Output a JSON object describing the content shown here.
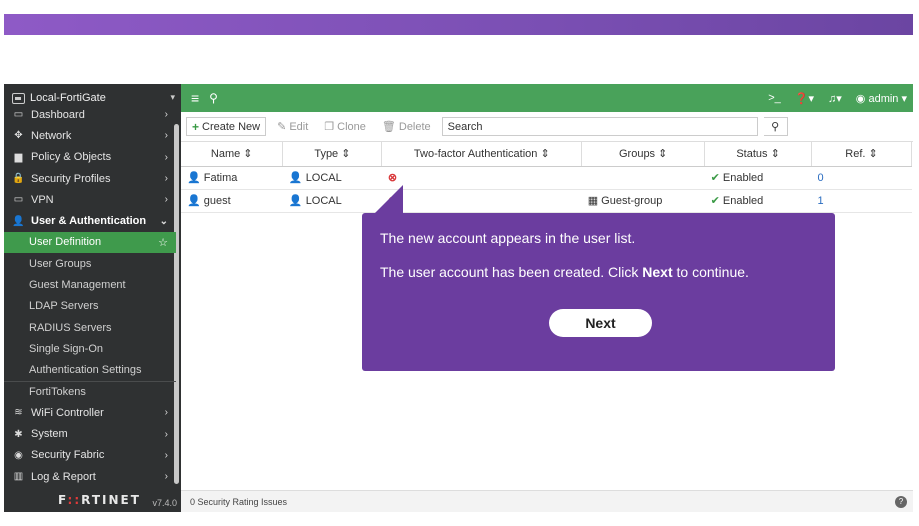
{
  "sidebar": {
    "device": "Local-FortiGate",
    "items": [
      {
        "icon": "dashboard-icon",
        "glyph": "▭",
        "label": "Dashboard"
      },
      {
        "icon": "network-icon",
        "glyph": "✥",
        "label": "Network"
      },
      {
        "icon": "policy-icon",
        "glyph": "▆",
        "label": "Policy & Objects"
      },
      {
        "icon": "lock-icon",
        "glyph": "🔒",
        "label": "Security Profiles"
      },
      {
        "icon": "vpn-icon",
        "glyph": "▭",
        "label": "VPN"
      },
      {
        "icon": "user-icon",
        "glyph": "👤",
        "label": "User & Authentication"
      }
    ],
    "subitems": [
      "User Definition",
      "User Groups",
      "Guest Management",
      "LDAP Servers",
      "RADIUS Servers",
      "Single Sign-On",
      "Authentication Settings",
      "FortiTokens"
    ],
    "items2": [
      {
        "icon": "wifi-icon",
        "glyph": "≋",
        "label": "WiFi Controller"
      },
      {
        "icon": "gear-icon",
        "glyph": "✱",
        "label": "System"
      },
      {
        "icon": "fabric-icon",
        "glyph": "◉",
        "label": "Security Fabric"
      },
      {
        "icon": "chart-icon",
        "glyph": "▥",
        "label": "Log & Report"
      }
    ],
    "brand_a": "F",
    "brand_b": "::",
    "brand_c": "RTINET",
    "version": "v7.4.0"
  },
  "topbar": {
    "admin": "admin"
  },
  "toolbar": {
    "create": "Create New",
    "edit": "Edit",
    "clone": "Clone",
    "delete": "Delete",
    "search_placeholder": "Search"
  },
  "table": {
    "headers": [
      "Name ⇕",
      "Type ⇕",
      "Two-factor Authentication ⇕",
      "Groups ⇕",
      "Status ⇕",
      "Ref. ⇕"
    ],
    "rows": [
      {
        "name": "Fatima",
        "type": "LOCAL",
        "groups": "",
        "status": "Enabled",
        "ref": "0"
      },
      {
        "name": "guest",
        "type": "LOCAL",
        "groups": "Guest-group",
        "status": "Enabled",
        "ref": "1"
      }
    ]
  },
  "statusbar": {
    "text": "0  Security Rating Issues"
  },
  "tooltip": {
    "line1": "The new account appears in the user list.",
    "line2_pre": "The user account has been created. Click ",
    "line2_bold": "Next",
    "line2_post": " to continue.",
    "next_label": "Next"
  },
  "colors": {
    "accent": "#49a25a",
    "tooltip": "#6b3d9f",
    "banner": "#8e5ac6"
  }
}
